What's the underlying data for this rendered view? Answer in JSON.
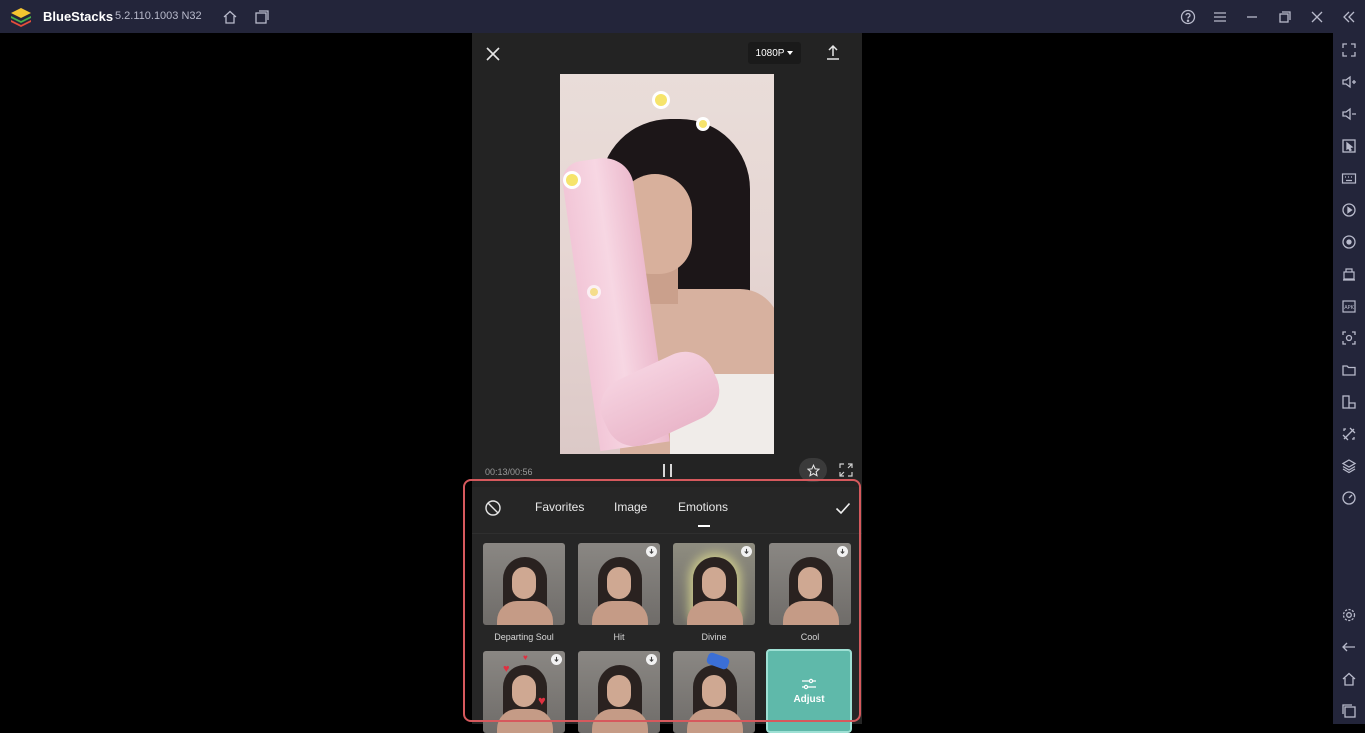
{
  "window": {
    "app_name": "BlueStacks",
    "version": "5.2.110.1003 N32",
    "top_icons": [
      "home-icon",
      "multi-instance-icon",
      "help-icon",
      "menu-icon",
      "minimize-icon",
      "restore-icon",
      "close-icon",
      "collapse-sidebar-icon"
    ]
  },
  "sidebar": {
    "items": [
      "fullscreen-icon",
      "volume-up-icon",
      "volume-down-icon",
      "pointer-icon",
      "keyboard-icon",
      "macro-record-icon",
      "sync-icon",
      "shake-icon",
      "apk-icon",
      "screenshot-icon",
      "folder-icon",
      "rotate-icon",
      "eco-mode-icon",
      "layers-icon",
      "speedometer-icon",
      "settings-icon",
      "back-icon",
      "home-icon",
      "recent-apps-icon"
    ]
  },
  "editor": {
    "resolution": "1080P",
    "time": "00:13/00:56"
  },
  "effects": {
    "tabs": [
      "Favorites",
      "Image",
      "Emotions"
    ],
    "active_tab": "Emotions",
    "items": [
      {
        "label": "Departing Soul",
        "download": false
      },
      {
        "label": "Hit",
        "download": true
      },
      {
        "label": "Divine",
        "download": true
      },
      {
        "label": "Cool",
        "download": true
      },
      {
        "label": "",
        "download": true
      },
      {
        "label": "",
        "download": true
      },
      {
        "label": "",
        "download": false
      }
    ],
    "adjust_label": "Adjust"
  },
  "colors": {
    "titlebar": "#23253a",
    "panel": "#262626",
    "highlight_border": "#d6595d",
    "adjust_tile": "#5fb9aa"
  }
}
